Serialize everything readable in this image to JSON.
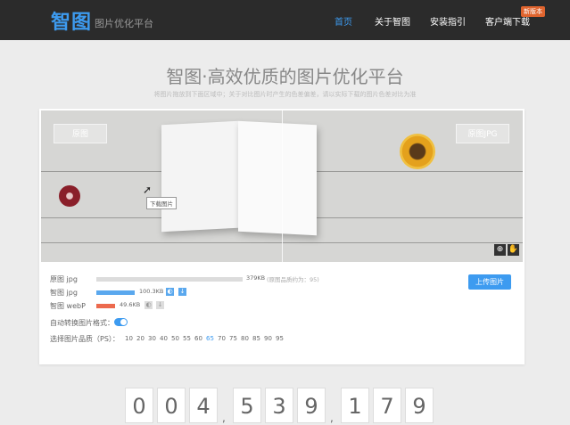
{
  "nav": {
    "logo": "智图",
    "tagline": "图片优化平台",
    "links": [
      "首页",
      "关于智图",
      "安装指引",
      "客户端下载"
    ],
    "badge": "新版本"
  },
  "hero": {
    "title": "智图·高效优质的图片优化平台",
    "hint": "将图片拖放到下面区域中；关于对比图片时产生的色差偏差，请以实际下载的图片色差对比为准"
  },
  "preview": {
    "label_left": "原图",
    "label_right": "原图JPG"
  },
  "results": [
    {
      "name": "原图 jpg",
      "size": "379KB",
      "note": "(原图品质约为：95)",
      "ratio": 1.0,
      "color": "#dcdcdc"
    },
    {
      "name": "智图 jpg",
      "size": "100.3KB",
      "note": "",
      "ratio": 0.265,
      "color": "#5aa8ee"
    },
    {
      "name": "智图 webP",
      "size": "49.6KB",
      "note": "",
      "ratio": 0.131,
      "color": "#ec6a4e"
    }
  ],
  "upload_button": "上传图片",
  "tooltip": "下载图片",
  "auto_convert_label": "自动转换图片格式：",
  "auto_convert_on": true,
  "quality": {
    "label": "选择图片品质（PS）：",
    "options": [
      "10",
      "20",
      "30",
      "40",
      "50",
      "55",
      "60",
      "65",
      "70",
      "75",
      "80",
      "85",
      "90",
      "95"
    ],
    "selected": "65"
  },
  "counter": {
    "digits": [
      "0",
      "0",
      "4",
      "5",
      "3",
      "9",
      "1",
      "7",
      "9"
    ],
    "separator": ","
  },
  "colors": {
    "accent": "#3d9bf0",
    "webp": "#ec6a4e",
    "navbar": "#2b2b2b"
  }
}
